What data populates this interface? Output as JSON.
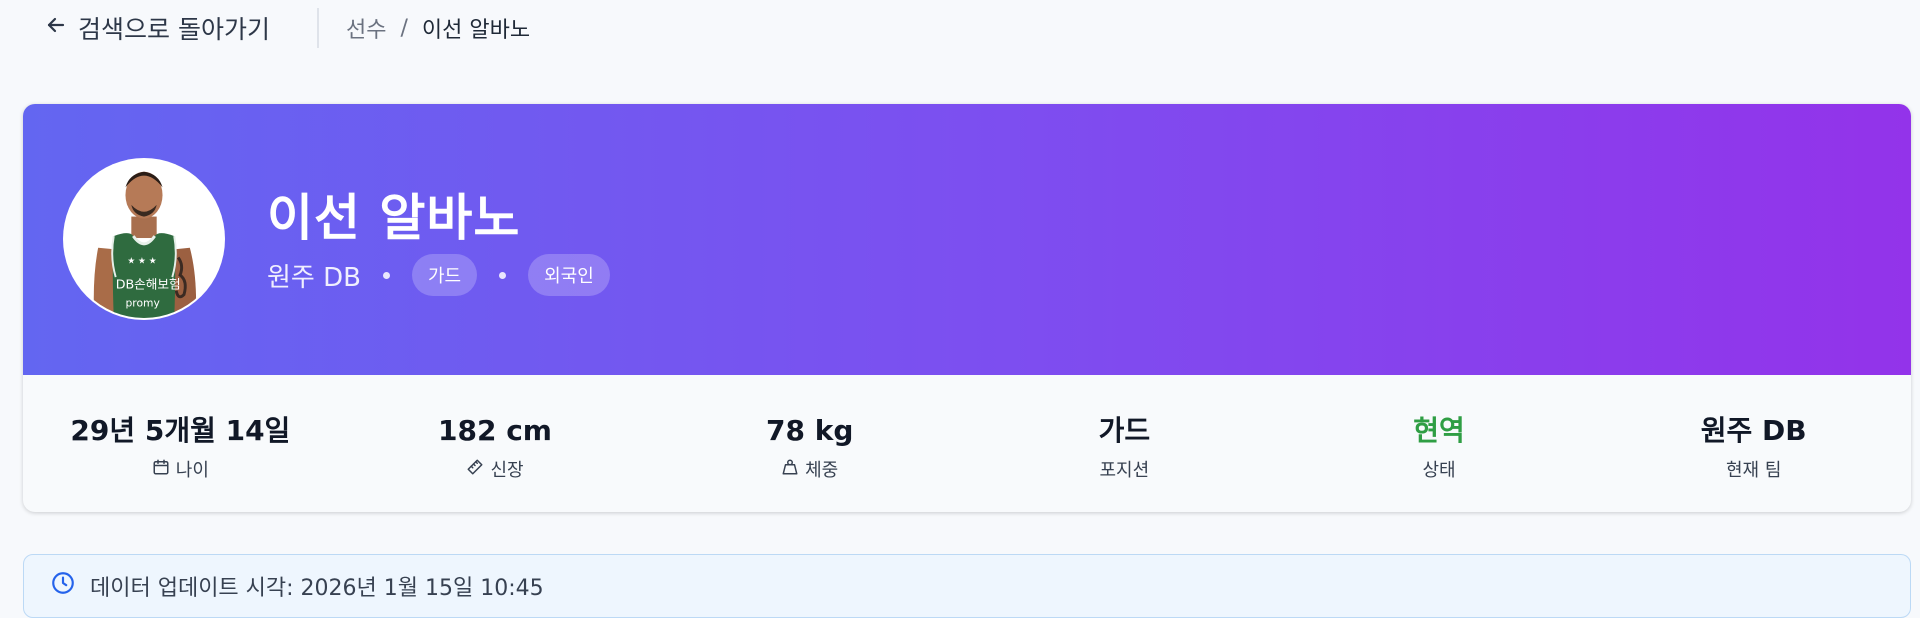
{
  "nav": {
    "back_label": "검색으로 돌아가기",
    "breadcrumb": {
      "parent": "선수",
      "separator": "/",
      "current": "이선 알바노"
    }
  },
  "player": {
    "name": "이선 알바노",
    "team": "원주 DB",
    "position_badge": "가드",
    "origin_badge": "외국인",
    "jersey_text": "DB손해보험"
  },
  "stats": [
    {
      "value": "29년 5개월 14일",
      "label": "나이",
      "icon": "calendar-icon"
    },
    {
      "value": "182 cm",
      "label": "신장",
      "icon": "ruler-icon"
    },
    {
      "value": "78 kg",
      "label": "체중",
      "icon": "weight-icon"
    },
    {
      "value": "가드",
      "label": "포지션",
      "icon": ""
    },
    {
      "value": "현역",
      "label": "상태",
      "icon": "",
      "color": "#2f9e44"
    },
    {
      "value": "원주 DB",
      "label": "현재 팀",
      "icon": ""
    }
  ],
  "update": {
    "text": "데이터 업데이트 시각: 2026년 1월 15일 10:45",
    "icon": "clock-icon"
  },
  "colors": {
    "hero_start": "#6366f1",
    "hero_end": "#9333ea",
    "active_status": "#2f9e44"
  }
}
